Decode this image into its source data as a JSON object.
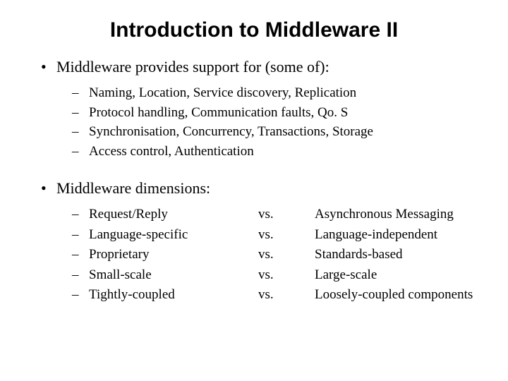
{
  "title": "Introduction to Middleware II",
  "section1": {
    "heading": "Middleware provides support for (some of):",
    "items": [
      "Naming, Location, Service discovery, Replication",
      "Protocol handling, Communication faults, Qo. S",
      "Synchronisation, Concurrency, Transactions, Storage",
      "Access control, Authentication"
    ]
  },
  "section2": {
    "heading": "Middleware dimensions:",
    "rows": [
      {
        "left": "Request/Reply",
        "vs": "vs.",
        "right": "Asynchronous Messaging"
      },
      {
        "left": "Language-specific",
        "vs": "vs.",
        "right": "Language-independent"
      },
      {
        "left": "Proprietary",
        "vs": "vs.",
        "right": "Standards-based"
      },
      {
        "left": "Small-scale",
        "vs": "vs.",
        "right": "Large-scale"
      },
      {
        "left": "Tightly-coupled",
        "vs": "vs.",
        "right": "Loosely-coupled components"
      }
    ]
  },
  "glyphs": {
    "bullet": "•",
    "dash": "–"
  }
}
